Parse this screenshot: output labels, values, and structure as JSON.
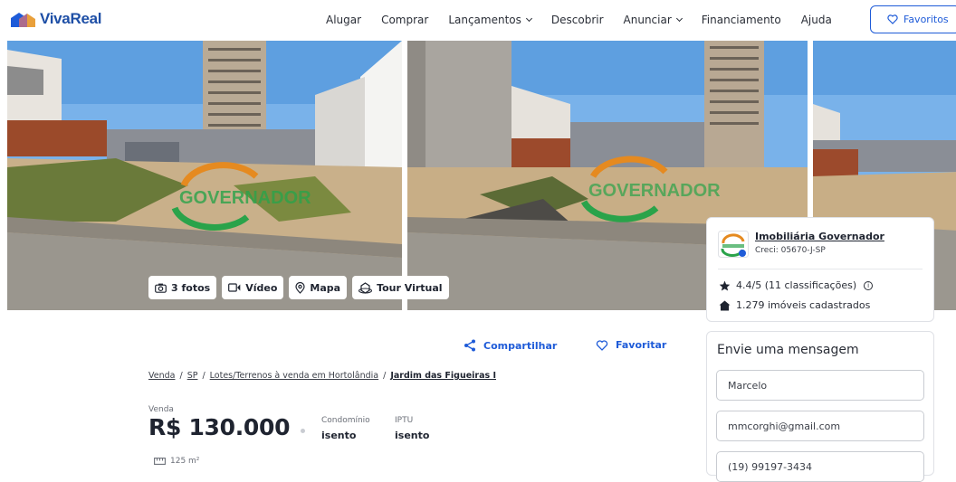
{
  "header": {
    "logo_text": "VivaReal",
    "nav": [
      {
        "label": "Alugar",
        "dropdown": false
      },
      {
        "label": "Comprar",
        "dropdown": false
      },
      {
        "label": "Lançamentos",
        "dropdown": true
      },
      {
        "label": "Descobrir",
        "dropdown": false
      },
      {
        "label": "Anunciar",
        "dropdown": true
      },
      {
        "label": "Financiamento",
        "dropdown": false
      },
      {
        "label": "Ajuda",
        "dropdown": false
      }
    ],
    "favorites_label": "Favoritos"
  },
  "gallery": {
    "watermark": "GOVERNADOR",
    "buttons": {
      "photos": "3 fotos",
      "video": "Vídeo",
      "map": "Mapa",
      "tour": "Tour Virtual"
    }
  },
  "agent": {
    "name": "Imobiliária Governador",
    "creci": "Creci: 05670-J-SP",
    "rating": "4.4/5 (11 classificações)",
    "listings": "1.279 imóveis cadastrados"
  },
  "message": {
    "title": "Envie uma mensagem",
    "name_value": "Marcelo",
    "email_value": "mmcorghi@gmail.com",
    "phone_value": "(19) 99197-3434"
  },
  "actions": {
    "share": "Compartilhar",
    "favorite": "Favoritar"
  },
  "breadcrumb": [
    "Venda",
    "SP",
    "Lotes/Terrenos à venda em Hortolândia",
    "Jardim das Figueiras I"
  ],
  "price": {
    "label": "Venda",
    "value": "R$ 130.000",
    "condo_label": "Condomínio",
    "condo_value": "isento",
    "iptu_label": "IPTU",
    "iptu_value": "isento"
  },
  "area": "125 m²",
  "colors": {
    "accent": "#1e5bd8",
    "brand": "#1e4fa6"
  }
}
